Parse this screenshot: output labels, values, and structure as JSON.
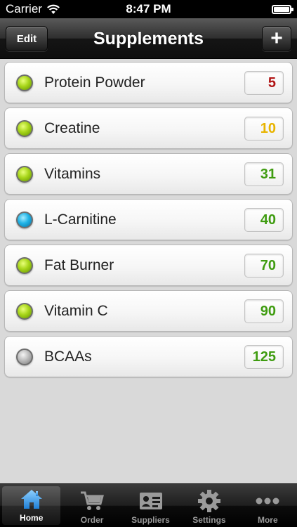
{
  "status_bar": {
    "carrier": "Carrier",
    "time": "8:47 PM"
  },
  "nav": {
    "title": "Supplements",
    "edit_label": "Edit",
    "add_label": "+"
  },
  "colors": {
    "count_low": "#b11414",
    "count_warn": "#e8b400",
    "count_ok": "#3f9c10"
  },
  "items": [
    {
      "label": "Protein Powder",
      "count": "5",
      "status": "green",
      "count_color": "#b11414"
    },
    {
      "label": "Creatine",
      "count": "10",
      "status": "green",
      "count_color": "#e8b400"
    },
    {
      "label": "Vitamins",
      "count": "31",
      "status": "green",
      "count_color": "#3f9c10"
    },
    {
      "label": "L-Carnitine",
      "count": "40",
      "status": "blue",
      "count_color": "#3f9c10"
    },
    {
      "label": "Fat Burner",
      "count": "70",
      "status": "green",
      "count_color": "#3f9c10"
    },
    {
      "label": "Vitamin C",
      "count": "90",
      "status": "green",
      "count_color": "#3f9c10"
    },
    {
      "label": "BCAAs",
      "count": "125",
      "status": "gray",
      "count_color": "#3f9c10"
    }
  ],
  "tabs": [
    {
      "label": "Home",
      "icon": "home-icon",
      "active": true
    },
    {
      "label": "Order",
      "icon": "cart-icon",
      "active": false
    },
    {
      "label": "Suppliers",
      "icon": "contact-card-icon",
      "active": false
    },
    {
      "label": "Settings",
      "icon": "gear-icon",
      "active": false
    },
    {
      "label": "More",
      "icon": "more-dots-icon",
      "active": false
    }
  ]
}
